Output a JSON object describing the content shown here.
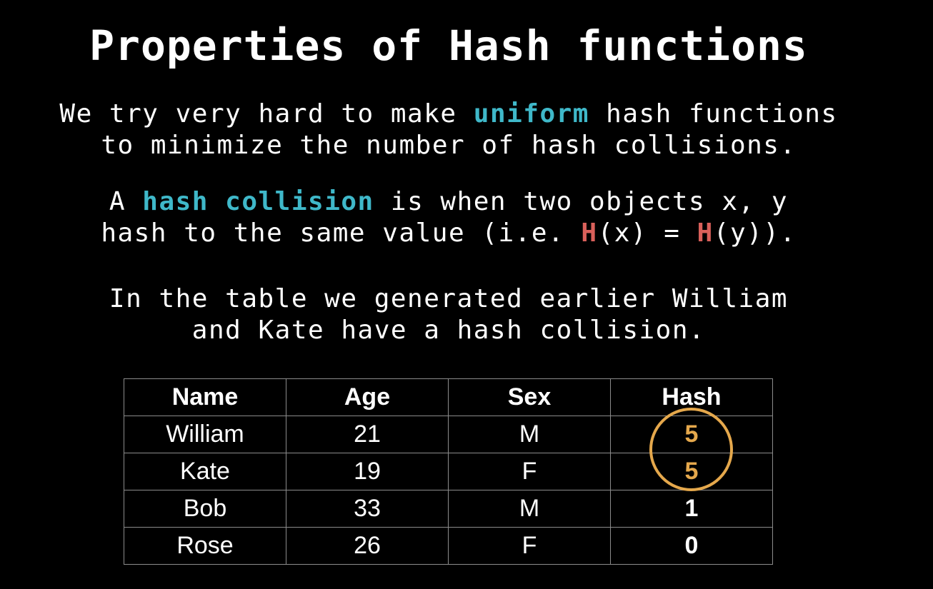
{
  "slide": {
    "title": "Properties of Hash functions",
    "para1": {
      "line1_pre": "We try very hard to make ",
      "line1_highlight": "uniform",
      "line1_post": " hash functions",
      "line2": "to minimize the number of hash collisions."
    },
    "para2": {
      "line1_pre": "A ",
      "line1_highlight": "hash collision",
      "line1_post": " is when two objects x, y",
      "line2_a": "hash to the same value (i.e. ",
      "line2_h1": "H",
      "line2_b": "(x) = ",
      "line2_h2": "H",
      "line2_c": "(y))."
    },
    "para3": {
      "line1": "In the table we generated earlier William",
      "line2": "and Kate have a hash collision."
    },
    "table": {
      "headers": [
        "Name",
        "Age",
        "Sex",
        "Hash"
      ],
      "rows": [
        [
          "William",
          "21",
          "M",
          "5"
        ],
        [
          "Kate",
          "19",
          "F",
          "5"
        ],
        [
          "Bob",
          "33",
          "M",
          "1"
        ],
        [
          "Rose",
          "26",
          "F",
          "0"
        ]
      ]
    }
  },
  "colors": {
    "background": "#000000",
    "text": "#ffffff",
    "highlight_blue": "#3fb8c9",
    "highlight_red": "#d9605a",
    "collision_orange": "#e5a84c",
    "table_border": "#8c8c8c"
  }
}
